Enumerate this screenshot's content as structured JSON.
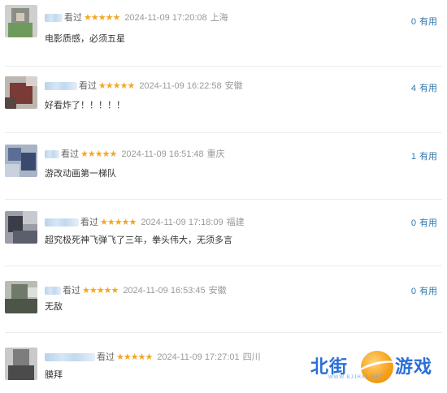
{
  "watched_label": "看过",
  "votes_suffix": "有用",
  "reviews": [
    {
      "stars": "★★★★★",
      "time": "2024-11-09 17:20:08",
      "location": "上海",
      "comment": "电影质感，必须五星",
      "votes": "0"
    },
    {
      "stars": "★★★★★",
      "time": "2024-11-09 16:22:58",
      "location": "安徽",
      "comment": "好看炸了！！！！！",
      "votes": "4"
    },
    {
      "stars": "★★★★★",
      "time": "2024-11-09 16:51:48",
      "location": "重庆",
      "comment": "游改动画第一梯队",
      "votes": "1"
    },
    {
      "stars": "★★★★★",
      "time": "2024-11-09 17:18:09",
      "location": "福建",
      "comment": "超究极死神飞弹飞了三年，拳头伟大，无须多言",
      "votes": "0"
    },
    {
      "stars": "★★★★★",
      "time": "2024-11-09 16:53:45",
      "location": "安徽",
      "comment": "无敌",
      "votes": "0"
    },
    {
      "stars": "★★★★★",
      "time": "2024-11-09 17:27:01",
      "location": "四川",
      "comment": "膜拜",
      "votes": ""
    }
  ],
  "watermark": {
    "left": "北街",
    "right": "游戏",
    "sub": "WWW.BJJHXS.NET"
  },
  "colors": {
    "star": "#f5a623",
    "link": "#3377aa",
    "watermark": "#2a6fd6"
  }
}
